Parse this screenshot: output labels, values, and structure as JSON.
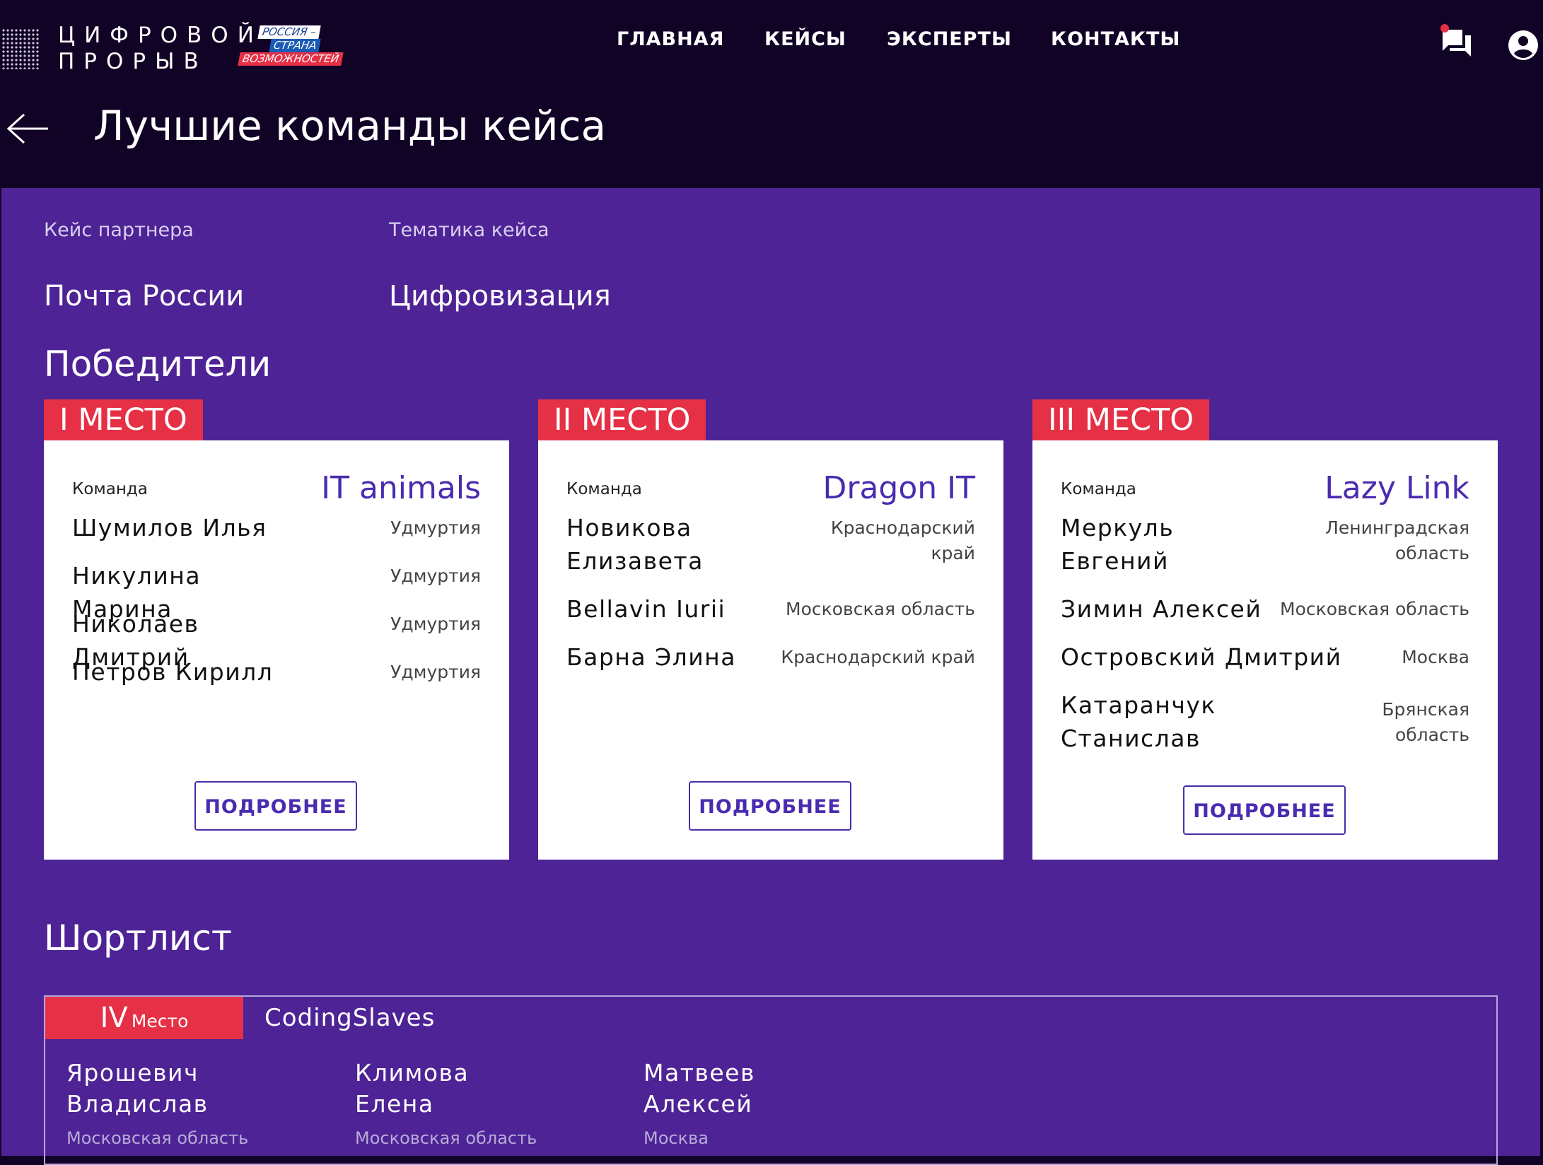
{
  "header": {
    "logo_line1": "ЦИФРОВОЙ",
    "logo_line2": "ПРОРЫВ",
    "badge_line1": "РОССИЯ –",
    "badge_line2": "СТРАНА",
    "badge_line3": "ВОЗМОЖНОСТЕЙ",
    "nav": [
      "ГЛАВНАЯ",
      "КЕЙСЫ",
      "ЭКСПЕРТЫ",
      "КОНТАКТЫ"
    ],
    "icons": [
      "chat-icon",
      "user-icon"
    ],
    "accent_color": "#e53046"
  },
  "page": {
    "title": "Лучшие команды кейса"
  },
  "case": {
    "partner_label": "Кейс партнера",
    "partner_value": "Почта России",
    "topic_label": "Тематика кейса",
    "topic_value": "Цифровизация"
  },
  "winners": {
    "title": "Победители",
    "team_label": "Команда",
    "more_label": "ПОДРОБНЕЕ",
    "cards": [
      {
        "place": "I МЕСТО",
        "team": "IT animals",
        "members": [
          {
            "name": "Шумилов Илья",
            "region": "Удмуртия"
          },
          {
            "name": "Никулина Марина",
            "region": "Удмуртия"
          },
          {
            "name": "Николаев Дмитрий",
            "region": "Удмуртия"
          },
          {
            "name": "Петров Кирилл",
            "region": "Удмуртия"
          }
        ]
      },
      {
        "place": "II МЕСТО",
        "team": "Dragon IT",
        "members": [
          {
            "name": "Новикова Елизавета",
            "region": "Краснодарский край"
          },
          {
            "name": "Bellavin Iurii",
            "region": "Московская область"
          },
          {
            "name": "Барна Элина",
            "region": "Краснодарский край"
          }
        ]
      },
      {
        "place": "III МЕСТО",
        "team": "Lazy Link",
        "members": [
          {
            "name": "Меркуль Евгений",
            "region": "Ленинградская область"
          },
          {
            "name": "Зимин Алексей",
            "region": "Московская область"
          },
          {
            "name": "Островский Дмитрий",
            "region": "Москва"
          },
          {
            "name": "Катаранчук Станислав",
            "region": "Брянская область"
          }
        ]
      }
    ]
  },
  "shortlist": {
    "title": "Шортлист",
    "place_num": "IV",
    "place_word": "Место",
    "team": "CodingSlaves",
    "members": [
      {
        "name": "Ярошевич Владислав",
        "region": "Московская область"
      },
      {
        "name": "Климова Елена",
        "region": "Московская область"
      },
      {
        "name": "Матвеев Алексей",
        "region": "Москва"
      }
    ]
  }
}
